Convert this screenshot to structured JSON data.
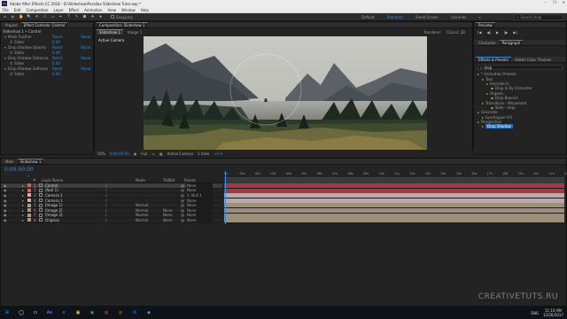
{
  "titlebar": {
    "app_icon": "Ae",
    "title": "Adobe After Effects CC 2018 - D:\\Slideshow\\Parallax Slideshow Tutor.aep *",
    "controls": [
      "–",
      "❐",
      "✕"
    ]
  },
  "menu": [
    "File",
    "Edit",
    "Composition",
    "Layer",
    "Effect",
    "Animation",
    "View",
    "Window",
    "Help"
  ],
  "toolbar": {
    "tools": [
      "⌂",
      "▸",
      "✋",
      "🔍",
      "⟲",
      "⎔",
      "▭",
      "✒",
      "T",
      "✎",
      "⬟",
      "✣",
      "★"
    ],
    "snapping_label": "Snapping",
    "workspaces": [
      "Default",
      "Standard",
      "Small Screen",
      "Libraries"
    ],
    "active_workspace": "Standard",
    "search_placeholder": "Search Help"
  },
  "project_panel": {
    "tabs": [
      "Project",
      "Effect Controls: Control"
    ],
    "header": "Slideshow 1 • Control",
    "effects": [
      {
        "name": "Mask Feather",
        "value": "Reset",
        "extra": "About"
      },
      {
        "name": "Slider",
        "value": "0.00",
        "indent": true
      },
      {
        "name": "Drop Shadow Opacity",
        "value": "Reset",
        "extra": "About"
      },
      {
        "name": "Slider",
        "value": "0.00",
        "indent": true
      },
      {
        "name": "Drop Shadow Distance",
        "value": "Reset",
        "extra": "About"
      },
      {
        "name": "Slider",
        "value": "0.00",
        "indent": true
      },
      {
        "name": "Drop Shadow Softness",
        "value": "Reset",
        "extra": "About"
      },
      {
        "name": "Slider",
        "value": "0.00",
        "indent": true
      }
    ]
  },
  "composition": {
    "tab": "Composition: Slideshow 1",
    "subtabs": [
      "Slideshow 1",
      "Image 1"
    ],
    "renderer_label": "Renderer:",
    "renderer_value": "Classic 3D",
    "view_label": "Active Camera",
    "bottom_bar": {
      "zoom": "50%",
      "time": "0:00:00:00",
      "resolution": "Full",
      "camera": "Active Camera",
      "views": "1 View",
      "offset": "+0.0"
    }
  },
  "right_panel": {
    "preview_tab": "Preview",
    "controls": [
      "|◀",
      "◀|",
      "▶",
      "|▶",
      "▶|"
    ],
    "char_tabs": [
      "Character",
      "Paragraph"
    ],
    "effects_tabs": [
      "Effects & Presets",
      "Adobe Color Themes"
    ],
    "search_value": "drop",
    "tree": [
      {
        "label": "* Animation Presets",
        "depth": 0
      },
      {
        "label": "Text",
        "depth": 1
      },
      {
        "label": "Animate In",
        "depth": 2
      },
      {
        "label": "Drop In By Character",
        "depth": 3
      },
      {
        "label": "Organic",
        "depth": 2
      },
      {
        "label": "Drop Bounce",
        "depth": 3
      },
      {
        "label": "Transitions - Movement",
        "depth": 1
      },
      {
        "label": "Slide - drop",
        "depth": 3
      },
      {
        "label": "Generate",
        "depth": 0
      },
      {
        "label": "Eyedropper Fill",
        "depth": 1
      },
      {
        "label": "Perspective",
        "depth": 0
      },
      {
        "label": "Drop Shadow",
        "depth": 1,
        "selected": true
      }
    ]
  },
  "timeline": {
    "tabs": [
      "Main",
      "Slideshow 1"
    ],
    "timecode": "0:00:00:00",
    "col_headers": {
      "num": "#",
      "name": "Layer Name",
      "mode": "Mode",
      "trkmat": "TrkMat",
      "parent": "Parent"
    },
    "ruler": [
      "0s",
      "01s",
      "02s",
      "03s",
      "04s",
      "05s",
      "06s",
      "07s",
      "08s",
      "09s",
      "10s",
      "11s",
      "12s",
      "13s",
      "14s",
      "15s",
      "16s",
      "17s",
      "18s",
      "19s",
      "20s",
      "21s",
      "22s"
    ],
    "layers": [
      {
        "num": "1",
        "name": "Control",
        "mode": "",
        "trkmat": "",
        "parent": "None",
        "color": "#e05e5e",
        "bar": "#a23a44"
      },
      {
        "num": "2",
        "name": "[Null 1]",
        "mode": "",
        "trkmat": "",
        "parent": "None",
        "color": "#e05e5e",
        "bar": "#a23a44"
      },
      {
        "num": "3",
        "name": "Camera 1",
        "mode": "",
        "trkmat": "",
        "parent": "3. Null 1",
        "color": "#e0a8a8",
        "bar": "#b9a9a8"
      },
      {
        "num": "4",
        "name": "Camera 1",
        "mode": "",
        "trkmat": "",
        "parent": "None",
        "color": "#e0a8a8",
        "bar": "#b9a9a8"
      },
      {
        "num": "5",
        "name": "[Image 1]",
        "mode": "Normal",
        "trkmat": "",
        "parent": "None",
        "color": "#b09a82",
        "bar": "#9e8f79"
      },
      {
        "num": "6",
        "name": "[Image 2]",
        "mode": "Normal",
        "trkmat": "None",
        "parent": "None",
        "color": "#b09a82",
        "bar": "#9e8f79"
      },
      {
        "num": "7",
        "name": "[Image 3]",
        "mode": "Normal",
        "trkmat": "None",
        "parent": "None",
        "color": "#b09a82",
        "bar": "#9e8f79"
      },
      {
        "num": "8",
        "name": "Original",
        "mode": "Normal",
        "trkmat": "None",
        "parent": "None",
        "color": "#b09a82",
        "bar": "#9e8f79"
      }
    ]
  },
  "watermark": "CREATIVETUTS.RU",
  "taskbar": {
    "apps": [
      {
        "icon": "⊞",
        "color": "#2d8ceb"
      },
      {
        "icon": "◯",
        "color": "#ffffff"
      },
      {
        "icon": "▭",
        "color": "#ffffff"
      },
      {
        "icon": "Ae",
        "color": "#9a7cff"
      },
      {
        "icon": "e",
        "color": "#2d8ceb"
      },
      {
        "icon": "▣",
        "color": "#f0c24b"
      },
      {
        "icon": "◉",
        "color": "#4caf50"
      },
      {
        "icon": "◍",
        "color": "#e94b3c"
      },
      {
        "icon": "◎",
        "color": "#ff7a00"
      },
      {
        "icon": "✉",
        "color": "#2d8ceb"
      },
      {
        "icon": "◈",
        "color": "#6fb3ff"
      }
    ],
    "time": "11:10 AM",
    "date": "12/26/2017",
    "lang": "ENG"
  }
}
